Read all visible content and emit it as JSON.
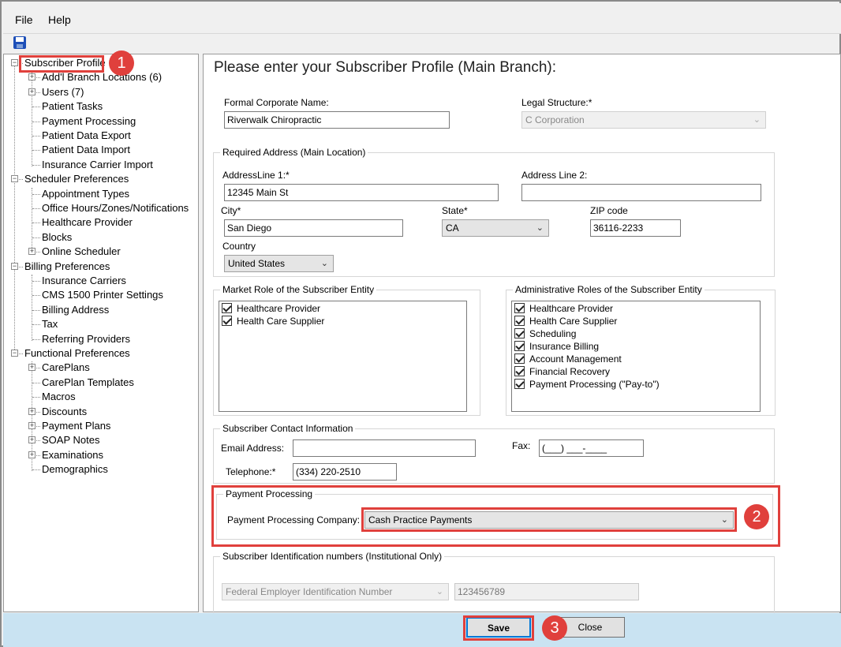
{
  "menu": {
    "file": "File",
    "help": "Help"
  },
  "tree": {
    "items": [
      {
        "label": "Subscriber Profile",
        "level": 0,
        "expander": "-"
      },
      {
        "label": "Add'l Branch Locations (6)",
        "level": 1,
        "expander": "+"
      },
      {
        "label": "Users (7)",
        "level": 1,
        "expander": "+"
      },
      {
        "label": "Patient Tasks",
        "level": 1,
        "expander": ""
      },
      {
        "label": "Payment Processing",
        "level": 1,
        "expander": ""
      },
      {
        "label": "Patient Data Export",
        "level": 1,
        "expander": ""
      },
      {
        "label": "Patient Data Import",
        "level": 1,
        "expander": ""
      },
      {
        "label": "Insurance Carrier Import",
        "level": 1,
        "expander": ""
      },
      {
        "label": "Scheduler Preferences",
        "level": 0,
        "expander": "-"
      },
      {
        "label": "Appointment Types",
        "level": 1,
        "expander": ""
      },
      {
        "label": "Office Hours/Zones/Notifications",
        "level": 1,
        "expander": ""
      },
      {
        "label": "Healthcare Provider",
        "level": 1,
        "expander": ""
      },
      {
        "label": "Blocks",
        "level": 1,
        "expander": ""
      },
      {
        "label": "Online Scheduler",
        "level": 1,
        "expander": "+"
      },
      {
        "label": "Billing Preferences",
        "level": 0,
        "expander": "-"
      },
      {
        "label": "Insurance Carriers",
        "level": 1,
        "expander": ""
      },
      {
        "label": "CMS 1500 Printer Settings",
        "level": 1,
        "expander": ""
      },
      {
        "label": "Billing Address",
        "level": 1,
        "expander": ""
      },
      {
        "label": "Tax",
        "level": 1,
        "expander": ""
      },
      {
        "label": "Referring Providers",
        "level": 1,
        "expander": ""
      },
      {
        "label": "Functional Preferences",
        "level": 0,
        "expander": "-"
      },
      {
        "label": "CarePlans",
        "level": 1,
        "expander": "+"
      },
      {
        "label": "CarePlan Templates",
        "level": 1,
        "expander": ""
      },
      {
        "label": "Macros",
        "level": 1,
        "expander": ""
      },
      {
        "label": "Discounts",
        "level": 1,
        "expander": "+"
      },
      {
        "label": "Payment Plans",
        "level": 1,
        "expander": "+"
      },
      {
        "label": "SOAP Notes",
        "level": 1,
        "expander": "+"
      },
      {
        "label": "Examinations",
        "level": 1,
        "expander": "+"
      },
      {
        "label": "Demographics",
        "level": 1,
        "expander": ""
      }
    ]
  },
  "badges": {
    "one": "1",
    "two": "2",
    "three": "3"
  },
  "form": {
    "title": "Please enter your Subscriber Profile (Main Branch):",
    "corp_name_label": "Formal Corporate Name:",
    "corp_name_value": "Riverwalk Chiropractic",
    "legal_label": "Legal Structure:*",
    "legal_value": "C Corporation",
    "address_group": "Required Address (Main Location)",
    "addr1_label": "AddressLine 1:*",
    "addr1_value": "12345 Main St",
    "addr2_label": "Address Line 2:",
    "addr2_value": "",
    "city_label": "City*",
    "city_value": "San Diego",
    "state_label": "State*",
    "state_value": "CA",
    "zip_label": "ZIP code",
    "zip_value": "36116-2233",
    "country_label": "Country",
    "country_value": "United States",
    "market_group": "Market Role of the Subscriber Entity",
    "market_roles": [
      "Healthcare Provider",
      "Health Care Supplier"
    ],
    "admin_group": "Administrative Roles of the Subscriber Entity",
    "admin_roles": [
      "Healthcare Provider",
      "Health Care Supplier",
      "Scheduling",
      "Insurance Billing",
      "Account Management",
      "Financial Recovery",
      "Payment Processing (\"Pay-to\")"
    ],
    "contact_group": "Subscriber Contact Information",
    "email_label": "Email Address:",
    "email_value": "",
    "fax_label": "Fax:",
    "fax_value": "(___) ___-____",
    "phone_label": "Telephone:*",
    "phone_value": "(334) 220-2510",
    "payment_group": "Payment Processing",
    "payment_company_label": "Payment Processing Company:",
    "payment_company_value": "Cash Practice Payments",
    "ident_group": "Subscriber Identification numbers (Institutional Only)",
    "ident_type_value": "Federal Employer Identification Number",
    "ident_number_value": "123456789"
  },
  "footer": {
    "save_label": "Save",
    "close_label": "Close"
  },
  "colors": {
    "highlight": "#e0403c",
    "footer_bg": "#c9e3f2",
    "accent": "#0078d7"
  }
}
